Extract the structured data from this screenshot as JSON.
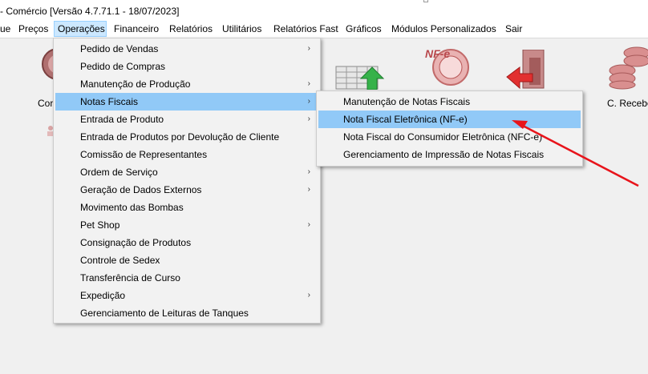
{
  "window": {
    "title": "- Comércio [Versão 4.7.71.1 - 18/07/2023]"
  },
  "menubar": {
    "items": [
      {
        "label": "ue"
      },
      {
        "label": "Preços"
      },
      {
        "label": "Operações"
      },
      {
        "label": "Financeiro"
      },
      {
        "label": "Relatórios"
      },
      {
        "label": "Utilitários"
      },
      {
        "label": "Relatórios Fast"
      },
      {
        "label": "Gráficos"
      },
      {
        "label": "Módulos Personalizados"
      },
      {
        "label": "Sair"
      }
    ]
  },
  "toolbar": {
    "left_label": "Cor",
    "right_label": "C. Recebe",
    "nfe_icon_text": "NF-e"
  },
  "operacoes_menu": {
    "items": [
      {
        "label": "Pedido de Vendas",
        "submenu": "›"
      },
      {
        "label": "Pedido de Compras",
        "submenu": ""
      },
      {
        "label": "Manutenção de Produção",
        "submenu": "›"
      },
      {
        "label": "Notas Fiscais",
        "submenu": "›"
      },
      {
        "label": "Entrada de Produto",
        "submenu": "›"
      },
      {
        "label": "Entrada de Produtos por Devolução de Cliente",
        "submenu": ""
      },
      {
        "label": "Comissão de Representantes",
        "submenu": ""
      },
      {
        "label": "Ordem de Serviço",
        "submenu": "›"
      },
      {
        "label": "Geração de Dados Externos",
        "submenu": "›"
      },
      {
        "label": "Movimento das Bombas",
        "submenu": ""
      },
      {
        "label": "Pet Shop",
        "submenu": "›"
      },
      {
        "label": "Consignação de Produtos",
        "submenu": ""
      },
      {
        "label": "Controle de Sedex",
        "submenu": ""
      },
      {
        "label": "Transferência de Curso",
        "submenu": ""
      },
      {
        "label": "Expedição",
        "submenu": "›"
      },
      {
        "label": "Gerenciamento de Leituras de Tanques",
        "submenu": ""
      }
    ],
    "highlighted": "Notas Fiscais"
  },
  "notas_fiscais_submenu": {
    "items": [
      {
        "label": "Manutenção de Notas Fiscais"
      },
      {
        "label": "Nota Fiscal Eletrônica (NF-e)"
      },
      {
        "label": "Nota Fiscal do Consumidor Eletrônica (NFC-e)"
      },
      {
        "label": "Gerenciamento de Impressão de Notas Fiscais"
      }
    ],
    "highlighted": "Nota Fiscal Eletrônica (NF-e)"
  },
  "colors": {
    "menu_highlight": "#91c9f7",
    "menubar_active": "#cce8ff",
    "annotation_arrow": "#e8141b"
  }
}
